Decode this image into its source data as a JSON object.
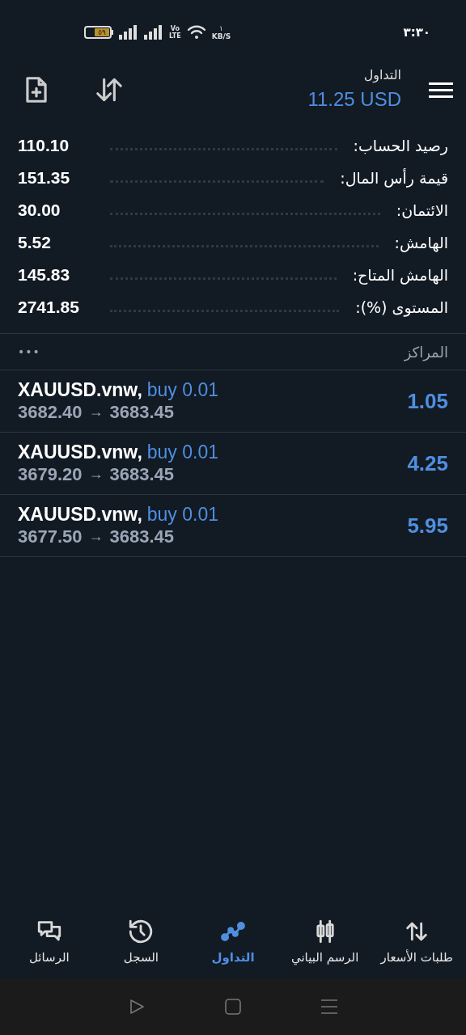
{
  "status_bar": {
    "time": "٣:٣٠",
    "battery": "٥٩",
    "network": [
      "Vo",
      "LTE"
    ],
    "speed_value": "١",
    "speed_unit": "KB/S"
  },
  "header": {
    "title": "التداول",
    "balance": "11.25 USD"
  },
  "account": [
    {
      "label": "رصيد الحساب:",
      "value": "110.10"
    },
    {
      "label": "قيمة رأس المال:",
      "value": "151.35"
    },
    {
      "label": "الائتمان:",
      "value": "30.00"
    },
    {
      "label": "الهامش:",
      "value": "5.52"
    },
    {
      "label": "الهامش المتاح:",
      "value": "145.83"
    },
    {
      "label": "المستوى (%):",
      "value": "2741.85"
    }
  ],
  "positions": {
    "title": "المراكز",
    "more": "•••",
    "items": [
      {
        "symbol": "XAUUSD.vnw,",
        "order": "buy 0.01",
        "open_price": "3682.40",
        "arrow": "→",
        "current_price": "3683.45",
        "profit": "1.05"
      },
      {
        "symbol": "XAUUSD.vnw,",
        "order": "buy 0.01",
        "open_price": "3679.20",
        "arrow": "→",
        "current_price": "3683.45",
        "profit": "4.25"
      },
      {
        "symbol": "XAUUSD.vnw,",
        "order": "buy 0.01",
        "open_price": "3677.50",
        "arrow": "→",
        "current_price": "3683.45",
        "profit": "5.95"
      }
    ]
  },
  "tabs": [
    {
      "kind": "quotes",
      "label": "طلبات الأسعار",
      "selected": false
    },
    {
      "kind": "chart",
      "label": "الرسم البياني",
      "selected": false
    },
    {
      "kind": "trade",
      "label": "التداول",
      "selected": true
    },
    {
      "kind": "history",
      "label": "السجل",
      "selected": false
    },
    {
      "kind": "messages",
      "label": "الرسائل",
      "selected": false
    }
  ]
}
